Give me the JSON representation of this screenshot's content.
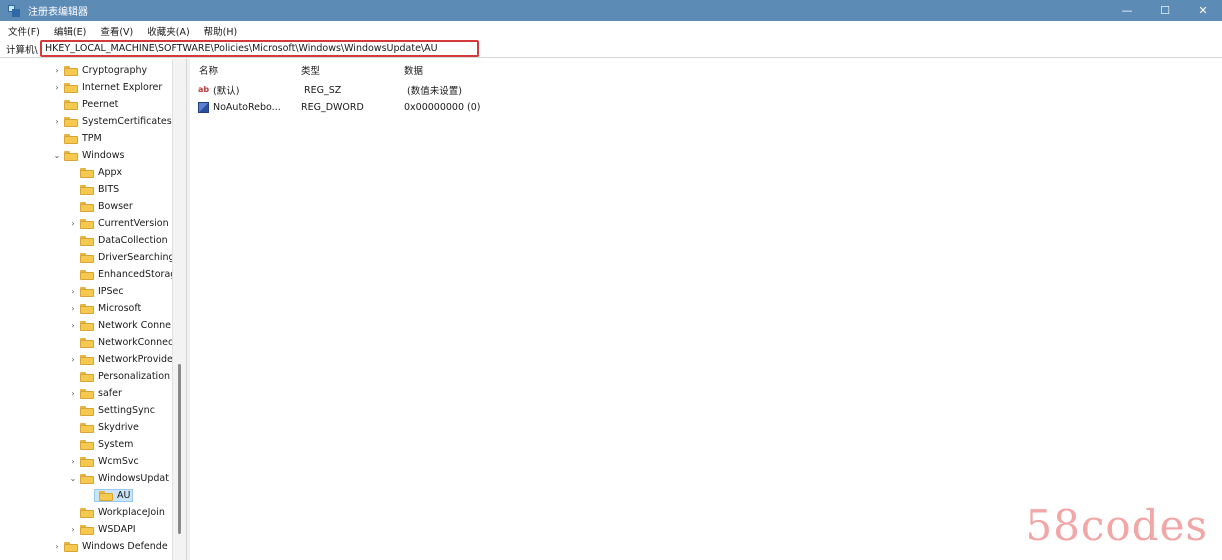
{
  "window": {
    "title": "注册表编辑器",
    "controls": {
      "minimize": "—",
      "maximize": "☐",
      "close": "✕"
    }
  },
  "menu": [
    "文件(F)",
    "编辑(E)",
    "查看(V)",
    "收藏夹(A)",
    "帮助(H)"
  ],
  "address": {
    "label": "计算机\\",
    "path": "HKEY_LOCAL_MACHINE\\SOFTWARE\\Policies\\Microsoft\\Windows\\WindowsUpdate\\AU"
  },
  "tree": {
    "items": [
      {
        "label": "Cryptography",
        "expander": "›"
      },
      {
        "label": "Internet Explorer",
        "expander": "›"
      },
      {
        "label": "Peernet",
        "expander": ""
      },
      {
        "label": "SystemCertificates",
        "expander": "›"
      },
      {
        "label": "TPM",
        "expander": ""
      },
      {
        "label": "Windows",
        "expander": "⌄"
      },
      {
        "label": "Appx",
        "expander": ""
      },
      {
        "label": "BITS",
        "expander": ""
      },
      {
        "label": "Bowser",
        "expander": ""
      },
      {
        "label": "CurrentVersion",
        "expander": "›"
      },
      {
        "label": "DataCollection",
        "expander": ""
      },
      {
        "label": "DriverSearching",
        "expander": ""
      },
      {
        "label": "EnhancedStorag",
        "expander": ""
      },
      {
        "label": "IPSec",
        "expander": "›"
      },
      {
        "label": "Microsoft",
        "expander": "›"
      },
      {
        "label": "Network Conne",
        "expander": "›"
      },
      {
        "label": "NetworkConnec",
        "expander": ""
      },
      {
        "label": "NetworkProvide",
        "expander": "›"
      },
      {
        "label": "Personalization",
        "expander": ""
      },
      {
        "label": "safer",
        "expander": "›"
      },
      {
        "label": "SettingSync",
        "expander": ""
      },
      {
        "label": "Skydrive",
        "expander": ""
      },
      {
        "label": "System",
        "expander": ""
      },
      {
        "label": "WcmSvc",
        "expander": "›"
      },
      {
        "label": "WindowsUpdat",
        "expander": "⌄"
      },
      {
        "label": "AU",
        "expander": ""
      },
      {
        "label": "WorkplaceJoin",
        "expander": ""
      },
      {
        "label": "WSDAPI",
        "expander": "›"
      },
      {
        "label": "Windows Defende",
        "expander": "›"
      }
    ]
  },
  "values_table": {
    "columns": [
      "名称",
      "类型",
      "数据"
    ],
    "rows": [
      {
        "icon": "string-value-icon",
        "icon_glyph": "ab",
        "name": "(默认)",
        "type": "REG_SZ",
        "data": "(数值未设置)"
      },
      {
        "icon": "binary-value-icon",
        "name": "NoAutoRebo...",
        "type": "REG_DWORD",
        "data": "0x00000000 (0)"
      }
    ]
  },
  "watermark": "58codes",
  "colors": {
    "titlebar": "#5c8bb6",
    "highlight_box": "#d53a3a",
    "folder": "#f5c94f",
    "selection": "#cce4f7"
  }
}
